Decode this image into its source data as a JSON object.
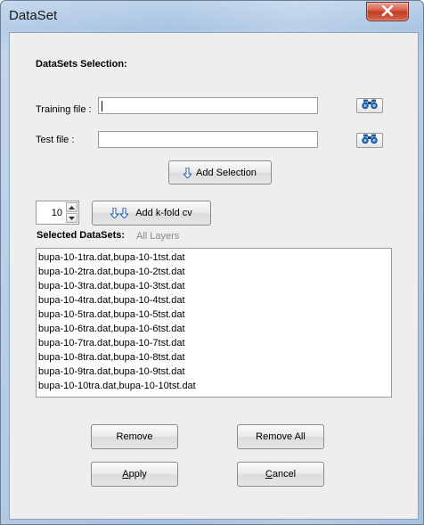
{
  "window": {
    "title": "DataSet"
  },
  "selection": {
    "title": "DataSets Selection:",
    "training_label": "Training file :",
    "training_value": "",
    "test_label": "Test file :",
    "test_value": "",
    "add_selection_label": "Add Selection"
  },
  "kfold": {
    "value": "10",
    "button_label": "Add k-fold cv"
  },
  "selected": {
    "title": "Selected DataSets:",
    "all_layers_label": "All Layers",
    "items": [
      "bupa-10-1tra.dat,bupa-10-1tst.dat",
      "bupa-10-2tra.dat,bupa-10-2tst.dat",
      "bupa-10-3tra.dat,bupa-10-3tst.dat",
      "bupa-10-4tra.dat,bupa-10-4tst.dat",
      "bupa-10-5tra.dat,bupa-10-5tst.dat",
      "bupa-10-6tra.dat,bupa-10-6tst.dat",
      "bupa-10-7tra.dat,bupa-10-7tst.dat",
      "bupa-10-8tra.dat,bupa-10-8tst.dat",
      "bupa-10-9tra.dat,bupa-10-9tst.dat",
      "bupa-10-10tra.dat,bupa-10-10tst.dat"
    ]
  },
  "buttons": {
    "remove": "Remove",
    "remove_all": "Remove All",
    "apply_mnemonic": "A",
    "apply_rest": "pply",
    "cancel_mnemonic": "C",
    "cancel_rest": "ancel"
  },
  "icons": {
    "close": "close-icon",
    "browse": "binoculars-icon",
    "add_selection": "arrow-down-icon",
    "kfold": "double-arrow-down-icon"
  },
  "colors": {
    "accent_icon": "#1f5fa8",
    "close_red": "#c33b22",
    "disabled_text": "#8a8a8a"
  }
}
